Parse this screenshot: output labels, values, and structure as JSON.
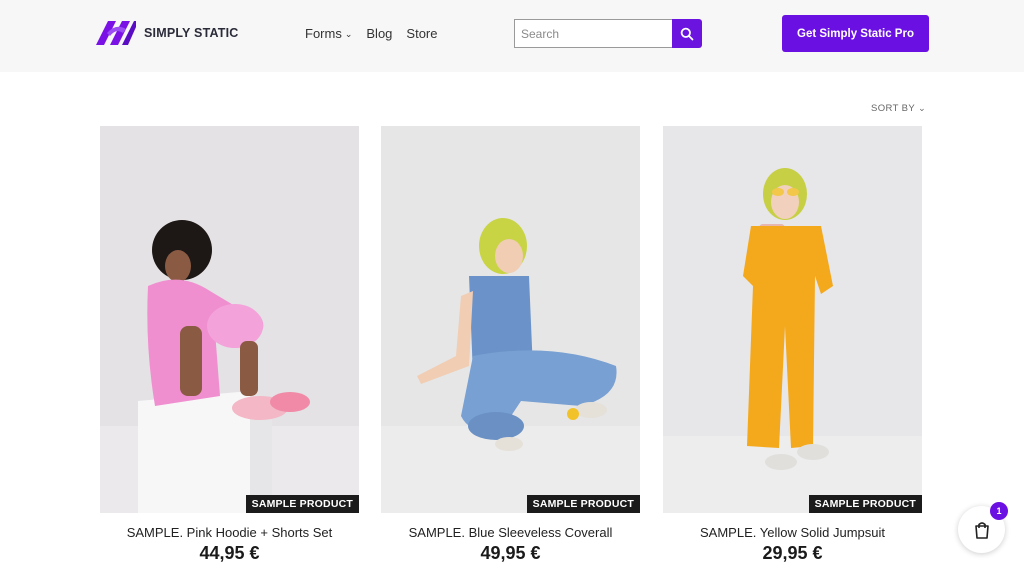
{
  "brand": {
    "name": "SIMPLY STATIC",
    "accent": "#6b10e3"
  },
  "nav": {
    "items": [
      {
        "label": "Forms",
        "has_dropdown": true
      },
      {
        "label": "Blog"
      },
      {
        "label": "Store"
      }
    ]
  },
  "search": {
    "placeholder": "Search",
    "value": ""
  },
  "cta": {
    "label": "Get Simply Static Pro"
  },
  "sort": {
    "label": "SORT BY"
  },
  "products": [
    {
      "name": "SAMPLE. Pink Hoodie + Shorts Set",
      "price": "44,95 €",
      "badge": "SAMPLE PRODUCT"
    },
    {
      "name": "SAMPLE. Blue Sleeveless Coverall",
      "price": "49,95 €",
      "badge": "SAMPLE PRODUCT"
    },
    {
      "name": "SAMPLE. Yellow Solid Jumpsuit",
      "price": "29,95 €",
      "badge": "SAMPLE PRODUCT"
    }
  ],
  "cart": {
    "count": "1"
  }
}
